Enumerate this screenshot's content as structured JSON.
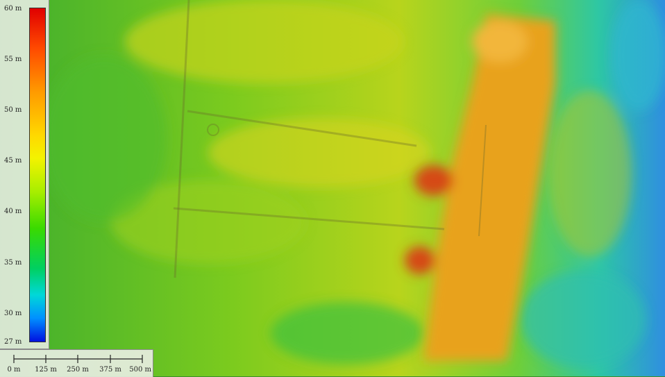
{
  "legend": {
    "ticks": [
      "60 m",
      "55 m",
      "50 m",
      "45 m",
      "40 m",
      "35 m",
      "30 m",
      "27 m"
    ],
    "min_value": 27,
    "max_value": 60,
    "colors": [
      "#e00000",
      "#ff9a00",
      "#f3f300",
      "#3ada00",
      "#00d8d8",
      "#0010e0"
    ]
  },
  "scale": {
    "labels": [
      "0 m",
      "125 m",
      "250 m",
      "375 m",
      "500 m"
    ]
  }
}
